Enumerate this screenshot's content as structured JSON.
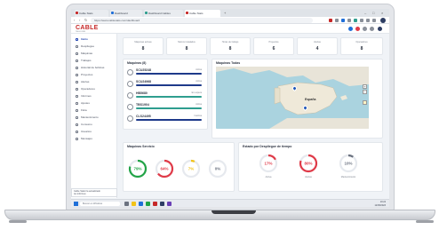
{
  "browser": {
    "tabs": [
      {
        "label": "Cable Stats"
      },
      {
        "label": "Dashboard"
      },
      {
        "label": "Dashboard Cables"
      },
      {
        "label": "Cable Stats"
      }
    ],
    "url": "https://www.cablestats.com/dashboard"
  },
  "app": {
    "logo": "CABLE",
    "logo_sub": "TELECOMS"
  },
  "sidebar": {
    "items": [
      {
        "label": "Inicio",
        "active": true
      },
      {
        "label": "Despliegue"
      },
      {
        "label": "Máquinas"
      },
      {
        "label": "Trabajos"
      },
      {
        "label": "Historial de bobinas"
      },
      {
        "label": "Proyectos"
      },
      {
        "label": "Alertas"
      },
      {
        "label": "Operadores"
      },
      {
        "label": "Informes"
      },
      {
        "label": "Ajustes"
      },
      {
        "label": "Flota"
      },
      {
        "label": "Mantenimiento"
      },
      {
        "label": "Consumo"
      },
      {
        "label": "Usuarios"
      },
      {
        "label": "Mensajes"
      }
    ],
    "footer": "Versión 2.1 © Cable Stats"
  },
  "stats": [
    {
      "title": "Máquinas activas",
      "value": "8"
    },
    {
      "title": "Metros instalados",
      "value": "8"
    },
    {
      "title": "Horas de trabajo",
      "value": "8"
    },
    {
      "title": "Proyectos",
      "value": "6"
    },
    {
      "title": "Alertas",
      "value": "4"
    },
    {
      "title": "Operadores",
      "value": "8"
    }
  ],
  "machines": {
    "title": "Máquinas (8)",
    "rows": [
      {
        "name": "SCU25248",
        "tag": "Activa",
        "color": "#1e3a8a"
      },
      {
        "name": "SCU24968",
        "tag": "Activa",
        "color": "#1e3a8a"
      },
      {
        "name": "HB5680",
        "tag": "En espera",
        "color": "#2f9e8f"
      },
      {
        "name": "TBS1904",
        "tag": "Activa",
        "color": "#2f9e8f"
      },
      {
        "name": "CLS24495",
        "tag": "Inactiva",
        "color": "#1e3a8a"
      }
    ]
  },
  "map": {
    "title": "Máquinas Todas",
    "country_label": "España"
  },
  "machine_gauges": {
    "title": "Máquinas Servicio",
    "items": [
      {
        "value": "79%",
        "fraction": 0.79,
        "color": "#22a447"
      },
      {
        "value": "64%",
        "fraction": 0.64,
        "color": "#e03a48"
      },
      {
        "value": "7%",
        "fraction": 0.07,
        "color": "#f2c318"
      },
      {
        "value": "0%",
        "fraction": 0.0,
        "color": "#b9bec6"
      }
    ]
  },
  "project_gauges": {
    "title": "Estado por Despliegue de tiempo",
    "items": [
      {
        "value": "17%",
        "fraction": 0.17,
        "color": "#e03a48",
        "caption": "Activa"
      },
      {
        "value": "80%",
        "fraction": 0.8,
        "color": "#e03a48",
        "caption": "Alertas"
      },
      {
        "value": "10%",
        "fraction": 0.1,
        "color": "#6b7280",
        "caption": "Mantenimiento"
      }
    ]
  },
  "notification": {
    "line1": "Cable Stats ha actualizado",
    "line2": "tus informes"
  },
  "taskbar": {
    "search_placeholder": "Buscar en Windows",
    "time": "10:24",
    "date": "12/05/2023"
  }
}
